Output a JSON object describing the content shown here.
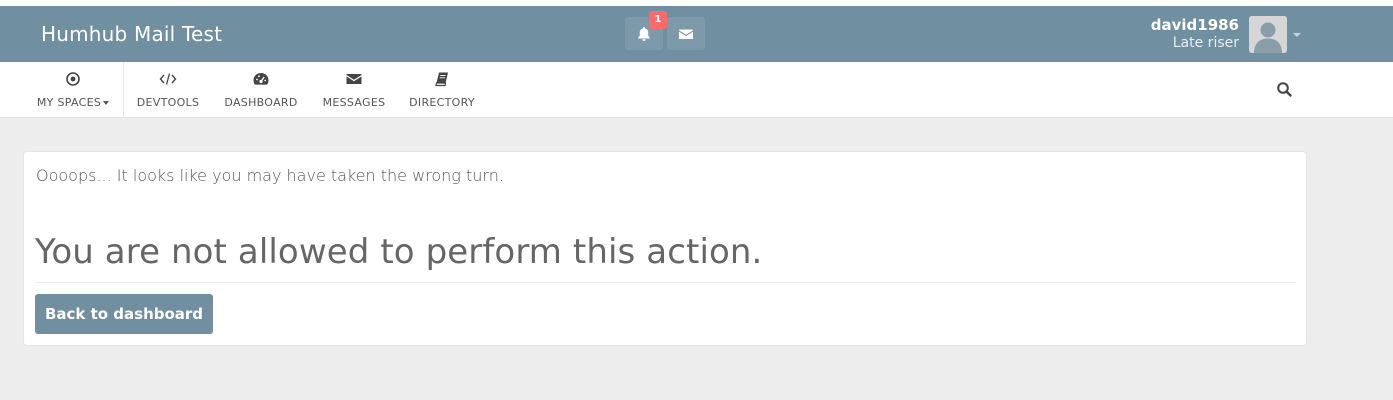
{
  "app": {
    "title": "Humhub Mail Test"
  },
  "notifications": {
    "count": "1"
  },
  "user": {
    "name": "david1986",
    "title": "Late riser"
  },
  "subnav": {
    "items": [
      {
        "label": "MY SPACES",
        "icon": "dot-circle-icon"
      },
      {
        "label": "DEVTOOLS",
        "icon": "code-icon"
      },
      {
        "label": "DASHBOARD",
        "icon": "dashboard-icon"
      },
      {
        "label": "MESSAGES",
        "icon": "envelope-icon"
      },
      {
        "label": "DIRECTORY",
        "icon": "book-icon"
      }
    ]
  },
  "error": {
    "message": "Oooops... It looks like you may have taken the wrong turn.",
    "heading": "You are not allowed to perform this action.",
    "button_label": "Back to dashboard"
  },
  "colors": {
    "topbar": "#708fa0",
    "badge": "#fc6a6a",
    "button": "#708fa0",
    "page_bg": "#ededed"
  }
}
